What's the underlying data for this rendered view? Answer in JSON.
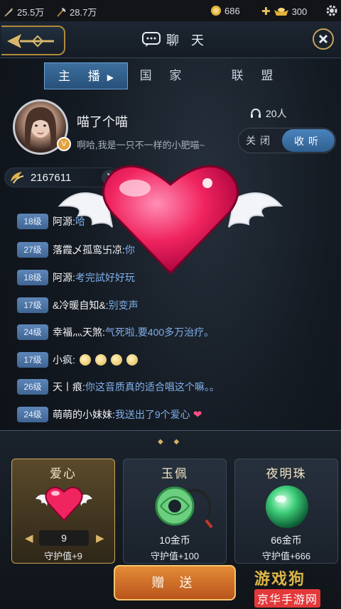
{
  "status": {
    "item1_value": "25.5万",
    "item2_value": "28.7万",
    "coins": "686",
    "gold": "300"
  },
  "header": {
    "title": "聊  天"
  },
  "tabs": [
    {
      "label": "主 播",
      "active": true
    },
    {
      "label": "国 家",
      "active": false
    },
    {
      "label": "联 盟",
      "active": false
    }
  ],
  "host": {
    "name": "喵了个喵",
    "badge": "V",
    "signature": "啊哈,我是一只不一样的小肥喵~",
    "listeners": "20人",
    "toggle_off": "关闭",
    "toggle_on": "收听",
    "coin_value": "2167611"
  },
  "messages": [
    {
      "level": "18级",
      "user": "阿源:",
      "text": "哈"
    },
    {
      "level": "27级",
      "user": "落霞乄孤鸾卐凉:",
      "text": "你"
    },
    {
      "level": "18级",
      "user": "阿源:",
      "text": "考完試好好玩"
    },
    {
      "level": "17级",
      "user": "&冷暖自知&:",
      "text": "别变声"
    },
    {
      "level": "24级",
      "user": "幸福灬天煞:",
      "text": "气死啦,要400多万治疗。"
    },
    {
      "level": "17级",
      "user": "小疯:",
      "text": ""
    },
    {
      "level": "26级",
      "user": "天丨痕:",
      "text": "你这音质真的适合唱这个嘛。。"
    },
    {
      "level": "24级",
      "user": "萌萌的小妹妹:",
      "text": "我送出了9个爱心"
    }
  ],
  "gifts": [
    {
      "name": "爱心",
      "quantity": "9",
      "guard": "守护值+9",
      "selected": true
    },
    {
      "name": "玉佩",
      "price": "10金币",
      "guard": "守护值+100",
      "selected": false
    },
    {
      "name": "夜明珠",
      "price": "66金币",
      "guard": "守护值+666",
      "selected": false
    }
  ],
  "send_label": "赠 送",
  "watermark": {
    "line1": "游戏狗",
    "line2": "京华手游网"
  },
  "colors": {
    "accent_blue": "#3f6594",
    "gold": "#c9a55a",
    "heart_pink": "#ff4f86",
    "message_blue": "#7fb0ea"
  }
}
